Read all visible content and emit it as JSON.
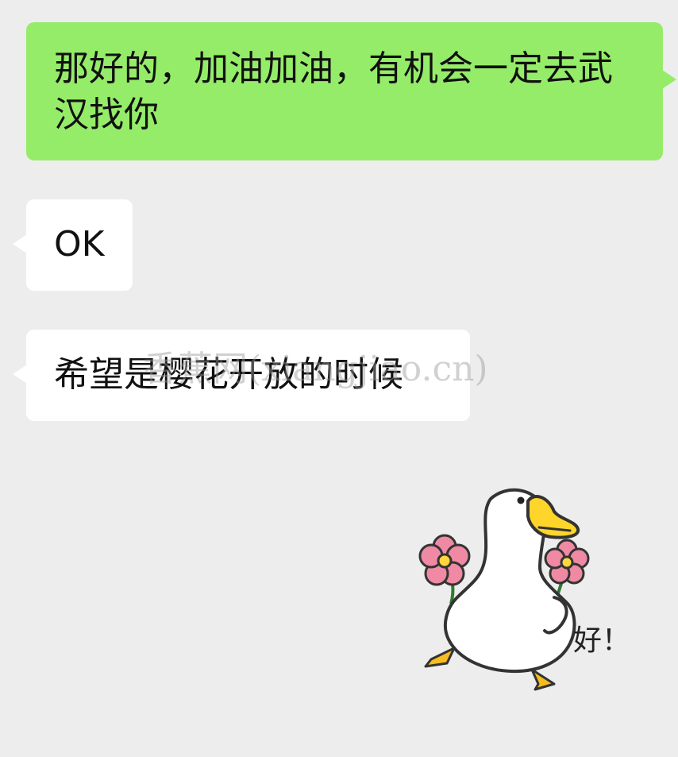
{
  "messages": [
    {
      "side": "out",
      "text": "那好的，加油加油，有机会一定去武汉找你"
    },
    {
      "side": "in",
      "text": "OK"
    },
    {
      "side": "in",
      "text": "希望是樱花开放的时候"
    }
  ],
  "watermark": "香蕉网(xiangjiao.cn)",
  "sticker": {
    "caption": "好！",
    "icon": "duck-with-flowers-sticker"
  },
  "colors": {
    "background": "#ededed",
    "outgoing_bubble": "#95ec69",
    "incoming_bubble": "#ffffff"
  }
}
